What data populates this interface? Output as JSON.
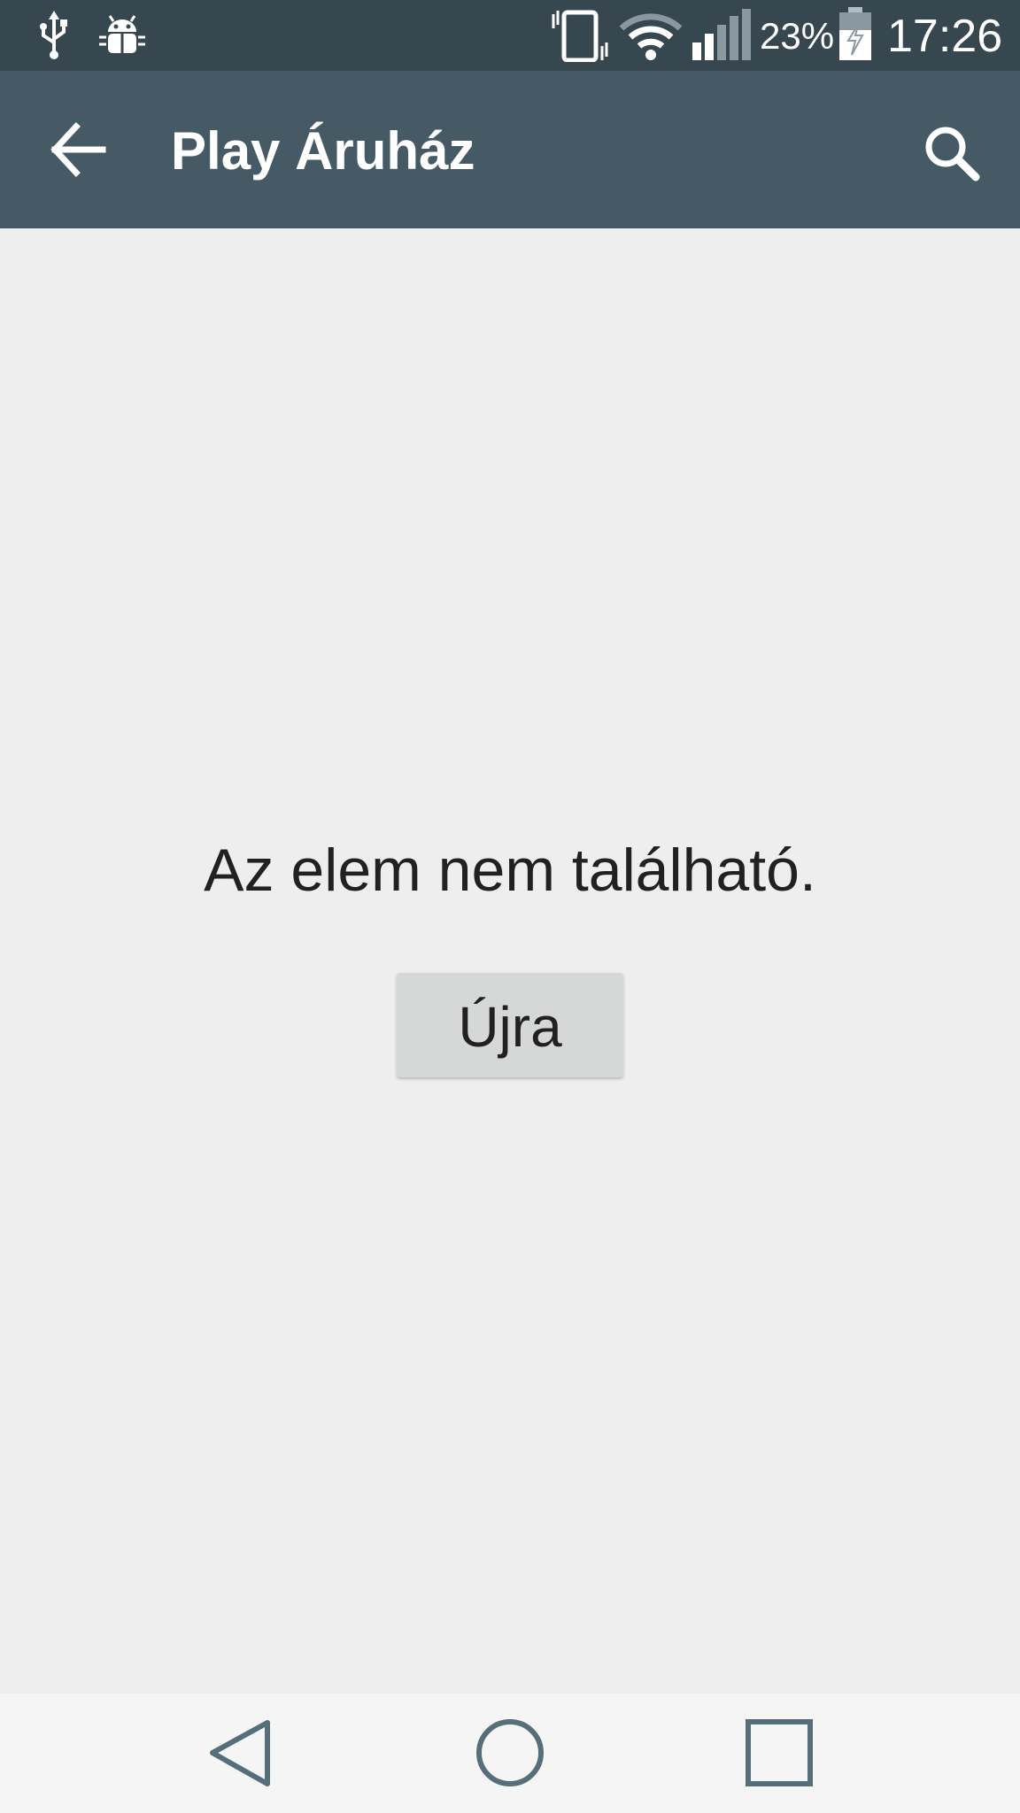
{
  "status_bar": {
    "left_icons": [
      "usb-icon",
      "android-debug-icon"
    ],
    "right_icons": [
      "vibrate-icon",
      "wifi-icon",
      "signal-icon",
      "battery-charging-icon"
    ],
    "battery_percent": "23%",
    "time": "17:26"
  },
  "app_bar": {
    "title": "Play Áruház",
    "back_icon": "arrow-back-icon",
    "search_icon": "search-icon"
  },
  "content": {
    "message": "Az elem nem található.",
    "retry_label": "Újra"
  },
  "nav_bar": {
    "buttons": [
      "back-triangle-icon",
      "home-circle-icon",
      "recents-square-icon"
    ]
  },
  "colors": {
    "status_bar": "#37474f",
    "app_bar": "#455a64",
    "background": "#eeeeee",
    "button": "#d6d7d7",
    "nav_bar": "#f5f5f5",
    "nav_icons": "#546e7a"
  }
}
